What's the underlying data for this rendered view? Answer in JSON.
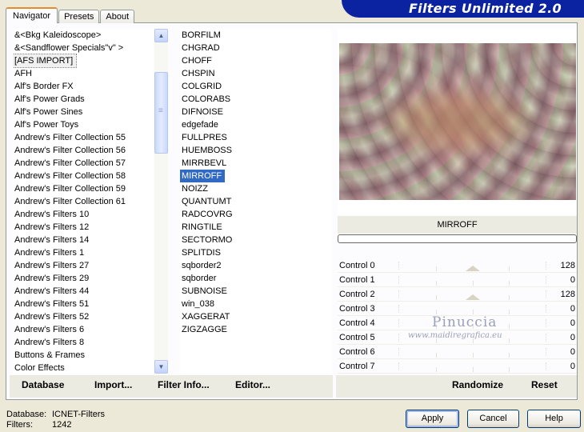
{
  "tabs": [
    {
      "label": "Navigator",
      "active": true
    },
    {
      "label": "Presets",
      "active": false
    },
    {
      "label": "About",
      "active": false
    }
  ],
  "app_title": "Filters Unlimited 2.0",
  "categories": [
    "&<Bkg Kaleidoscope>",
    "&<Sandflower Specials\"v\" >",
    "[AFS IMPORT]",
    "AFH",
    "Alf's Border FX",
    "Alf's Power Grads",
    "Alf's Power Sines",
    "Alf's Power Toys",
    "Andrew's Filter Collection 55",
    "Andrew's Filter Collection 56",
    "Andrew's Filter Collection 57",
    "Andrew's Filter Collection 58",
    "Andrew's Filter Collection 59",
    "Andrew's Filter Collection 61",
    "Andrew's Filters 10",
    "Andrew's Filters 12",
    "Andrew's Filters 14",
    "Andrew's Filters 1",
    "Andrew's Filters 27",
    "Andrew's Filters 29",
    "Andrew's Filters 44",
    "Andrew's Filters 51",
    "Andrew's Filters 52",
    "Andrew's Filters 6",
    "Andrew's Filters 8",
    "Buttons & Frames",
    "Color Effects"
  ],
  "selected_category": "[AFS IMPORT]",
  "filters": [
    "BORFILM",
    "CHGRAD",
    "CHOFF",
    "CHSPIN",
    "COLGRID",
    "COLORABS",
    "DIFNOISE",
    "edgefade",
    "FULLPRES",
    "HUEMBOSS",
    "MIRRBEVL",
    "MIRROFF",
    "NOIZZ",
    "QUANTUMT",
    "RADCOVRG",
    "RINGTILE",
    "SECTORMO",
    "SPLITDIS",
    "sqborder2",
    "sqborder",
    "SUBNOISE",
    "win_038",
    "XAGGERAT",
    "ZIGZAGGE"
  ],
  "selected_filter": "MIRROFF",
  "filter_name_display": "MIRROFF",
  "controls": [
    {
      "label": "Control 0",
      "value": "128",
      "level": 0.5
    },
    {
      "label": "Control 1",
      "value": "0",
      "level": 0
    },
    {
      "label": "Control 2",
      "value": "128",
      "level": 0.5
    },
    {
      "label": "Control 3",
      "value": "0",
      "level": 0
    },
    {
      "label": "Control 4",
      "value": "0",
      "level": 0
    },
    {
      "label": "Control 5",
      "value": "0",
      "level": 0
    },
    {
      "label": "Control 6",
      "value": "0",
      "level": 0
    },
    {
      "label": "Control 7",
      "value": "0",
      "level": 0
    }
  ],
  "watermark": {
    "name": "Pinuccia",
    "url": "www.maidiregrafica.eu"
  },
  "left_actions": {
    "database": "Database",
    "import": "Import...",
    "filter_info": "Filter Info...",
    "editor": "Editor..."
  },
  "right_actions": {
    "randomize": "Randomize",
    "reset": "Reset"
  },
  "status": {
    "database_label": "Database:",
    "database_value": "ICNET-Filters",
    "filters_label": "Filters:",
    "filters_value": "1242"
  },
  "buttons": {
    "apply": "Apply",
    "cancel": "Cancel",
    "help": "Help"
  },
  "colors": {
    "banner": "#0b23a0",
    "selection": "#316ac5",
    "dialog_bg": "#ece9d8"
  }
}
